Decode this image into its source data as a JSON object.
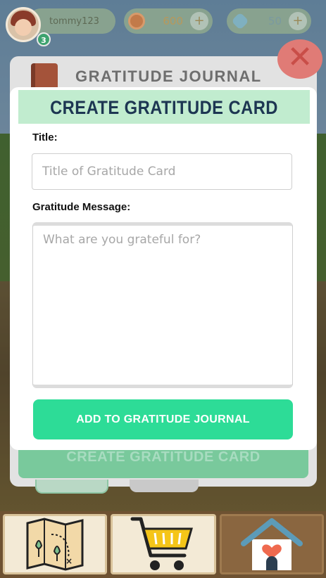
{
  "hud": {
    "username": "tommy123",
    "level": "3",
    "coins": "600",
    "coin_plus": "+",
    "gems": "50",
    "gem_plus": "+"
  },
  "journal": {
    "title": "GRATITUDE JOURNAL",
    "close_label": "✕",
    "create_button_label": "CREATE GRATITUDE CARD"
  },
  "modal": {
    "title": "CREATE GRATITUDE CARD",
    "title_label": "Title:",
    "title_placeholder": "Title of Gratitude Card",
    "title_value": "",
    "message_label": "Gratitude Message:",
    "message_placeholder": "What are you grateful for?",
    "message_value": "",
    "submit_label": "ADD TO GRATITUDE JOURNAL"
  },
  "bottom_nav": {
    "items": [
      {
        "icon": "map-icon"
      },
      {
        "icon": "shopping-cart-icon"
      },
      {
        "icon": "home-heart-icon"
      }
    ]
  },
  "colors": {
    "accent_green": "#2ddc97",
    "header_green": "#c1eccf",
    "title_navy": "#1d3652",
    "close_red": "#e07b76"
  }
}
